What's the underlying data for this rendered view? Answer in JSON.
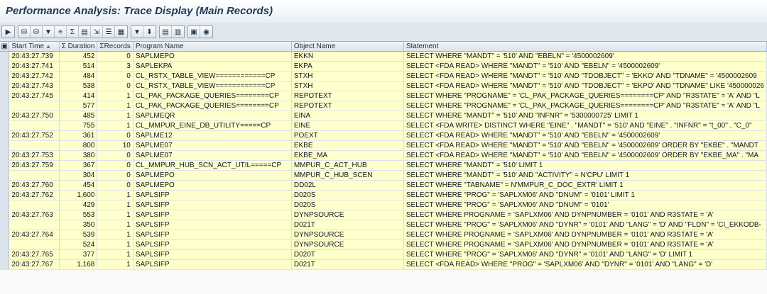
{
  "window": {
    "title": "Performance Analysis: Trace Display (Main Records)"
  },
  "toolbar": {
    "groups": [
      {
        "buttons": [
          {
            "name": "execute-icon",
            "glyph": "▶"
          }
        ]
      },
      {
        "buttons": [
          {
            "name": "find-icon",
            "glyph": "⛁"
          },
          {
            "name": "find-next-icon",
            "glyph": "⛁"
          },
          {
            "name": "filter-icon",
            "glyph": "▼"
          },
          {
            "name": "sort-icon",
            "glyph": "≡"
          },
          {
            "name": "sum-icon",
            "glyph": "Σ"
          },
          {
            "name": "layout-icon",
            "glyph": "▤"
          },
          {
            "name": "export-icon",
            "glyph": "⇲"
          },
          {
            "name": "details-icon",
            "glyph": "☰"
          },
          {
            "name": "view-icon",
            "glyph": "▦"
          }
        ]
      },
      {
        "buttons": [
          {
            "name": "down-icon",
            "glyph": "▼"
          },
          {
            "name": "bottom-icon",
            "glyph": "⬇"
          }
        ]
      },
      {
        "buttons": [
          {
            "name": "explain-icon",
            "glyph": "▤"
          },
          {
            "name": "abap-icon",
            "glyph": "▥"
          }
        ]
      },
      {
        "buttons": [
          {
            "name": "print-icon",
            "glyph": "▣"
          },
          {
            "name": "info-icon",
            "glyph": "◉"
          }
        ]
      }
    ]
  },
  "grid": {
    "columns": {
      "start_time": "Start Time",
      "duration": "Duration",
      "records": "Records",
      "program": "Program Name",
      "object": "Object Name",
      "statement": "Statement"
    },
    "rows": [
      {
        "start": "20:43:27.739",
        "dur": "452",
        "rec": "0",
        "prog": "SAPLMEPO",
        "obj": "EKKN",
        "stmt": "SELECT  WHERE \"MANDT\" = '510' AND \"EBELN\" = '4500002609'"
      },
      {
        "start": "20:43:27.741",
        "dur": "514",
        "rec": "3",
        "prog": "SAPLEKPA",
        "obj": "EKPA",
        "stmt": "SELECT <FDA READ>  WHERE \"MANDT\" = '510' AND \"EBELN\" = '4500002609'"
      },
      {
        "start": "20:43:27.742",
        "dur": "484",
        "rec": "0",
        "prog": "CL_RSTX_TABLE_VIEW============CP",
        "obj": "STXH",
        "stmt": "SELECT <FDA READ>  WHERE \"MANDT\" = '510' AND \"TDOBJECT\" = 'EKKO' AND \"TDNAME\" = '4500002609"
      },
      {
        "start": "20:43:27.743",
        "dur": "538",
        "rec": "0",
        "prog": "CL_RSTX_TABLE_VIEW============CP",
        "obj": "STXH",
        "stmt": "SELECT <FDA READ>  WHERE \"MANDT\" = '510' AND \"TDOBJECT\" = 'EKPO' AND \"TDNAME\" LIKE '450000026"
      },
      {
        "start": "20:43:27.745",
        "dur": "414",
        "rec": "1",
        "prog": "CL_PAK_PACKAGE_QUERIES========CP",
        "obj": "REPOTEXT",
        "stmt": "SELECT  WHERE \"PROGNAME\" = 'CL_PAK_PACKAGE_QUERIES========CP' AND \"R3STATE\" = 'A' AND \"L"
      },
      {
        "start": "",
        "dur": "577",
        "rec": "1",
        "prog": "CL_PAK_PACKAGE_QUERIES========CP",
        "obj": "REPOTEXT",
        "stmt": "SELECT  WHERE \"PROGNAME\" = 'CL_PAK_PACKAGE_QUERIES========CP' AND \"R3STATE\" = 'A' AND \"L"
      },
      {
        "start": "20:43:27.750",
        "dur": "485",
        "rec": "1",
        "prog": "SAPLMEQR",
        "obj": "EINA",
        "stmt": "SELECT  WHERE \"MANDT\" = '510' AND \"INFNR\" = '5300000725'  LIMIT 1"
      },
      {
        "start": "",
        "dur": "755",
        "rec": "1",
        "prog": "CL_MMPUR_EINE_DB_UTILITY=====CP",
        "obj": "EINE",
        "stmt": "SELECT <FDA WRITE> DISTINCT  WHERE \"EINE\" . \"MANDT\" = '510' AND \"EINE\" . \"INFNR\" = \"t_00\" . \"C_0\""
      },
      {
        "start": "20:43:27.752",
        "dur": "361",
        "rec": "0",
        "prog": "SAPLME12",
        "obj": "POEXT",
        "stmt": "SELECT <FDA READ>  WHERE \"MANDT\" = '510' AND \"EBELN\" = '4500002609'"
      },
      {
        "start": "",
        "dur": "800",
        "rec": "10",
        "prog": "SAPLME07",
        "obj": "EKBE",
        "stmt": "SELECT <FDA READ>  WHERE \"MANDT\" = '510' AND \"EBELN\" = '4500002609'  ORDER BY \"EKBE\" . \"MANDT"
      },
      {
        "start": "20:43:27.753",
        "dur": "380",
        "rec": "0",
        "prog": "SAPLME07",
        "obj": "EKBE_MA",
        "stmt": "SELECT <FDA READ>  WHERE \"MANDT\" = '510' AND \"EBELN\" = '4500002609'  ORDER BY \"EKBE_MA\" . \"MA"
      },
      {
        "start": "20:43:27.759",
        "dur": "367",
        "rec": "0",
        "prog": "CL_MMPUR_HUB_SCN_ACT_UTIL=====CP",
        "obj": "MMPUR_C_ACT_HUB",
        "stmt": "SELECT  WHERE \"MANDT\" = '510'  LIMIT 1"
      },
      {
        "start": "",
        "dur": "304",
        "rec": "0",
        "prog": "SAPLMEPO",
        "obj": "MMPUR_C_HUB_SCEN",
        "stmt": "SELECT  WHERE \"MANDT\" = '510'  AND \"ACTIVITY\" = N'CPU' LIMIT 1"
      },
      {
        "start": "20:43:27.760",
        "dur": "454",
        "rec": "0",
        "prog": "SAPLMEPO",
        "obj": "DD02L",
        "stmt": "SELECT WHERE \"TABNAME\" = N'MMPUR_C_DOC_EXTR' LIMIT 1"
      },
      {
        "start": "20:43:27.762",
        "dur": "1,600",
        "rec": "1",
        "prog": "SAPLSIFP",
        "obj": "D020S",
        "stmt": "SELECT  WHERE \"PROG\" = 'SAPLXM06' AND \"DNUM\" = '0101'  LIMIT 1"
      },
      {
        "start": "",
        "dur": "429",
        "rec": "1",
        "prog": "SAPLSIFP",
        "obj": "D020S",
        "stmt": "SELECT  WHERE \"PROG\" = 'SAPLXM06' AND \"DNUM\" = '0101'"
      },
      {
        "start": "20:43:27.763",
        "dur": "553",
        "rec": "1",
        "prog": "SAPLSIFP",
        "obj": "DYNPSOURCE",
        "stmt": "SELECT  WHERE PROGNAME = 'SAPLXM06' AND DYNPNUMBER = '0101'  AND R3STATE = 'A'"
      },
      {
        "start": "",
        "dur": "350",
        "rec": "1",
        "prog": "SAPLSIFP",
        "obj": "D021T",
        "stmt": "SELECT  WHERE \"PROG\" = 'SAPLXM06' AND \"DYNR\" = '0101' AND \"LANG\" = 'D' AND \"FLDN\" = 'CI_EKKODB-"
      },
      {
        "start": "20:43:27.764",
        "dur": "539",
        "rec": "1",
        "prog": "SAPLSIFP",
        "obj": "DYNPSOURCE",
        "stmt": "SELECT  WHERE PROGNAME = 'SAPLXM06' AND DYNPNUMBER = '0101'  AND R3STATE = 'A'"
      },
      {
        "start": "",
        "dur": "524",
        "rec": "1",
        "prog": "SAPLSIFP",
        "obj": "DYNPSOURCE",
        "stmt": "SELECT  WHERE PROGNAME = 'SAPLXM06' AND DYNPNUMBER = '0101'  AND R3STATE = 'A'"
      },
      {
        "start": "20:43:27.765",
        "dur": "377",
        "rec": "1",
        "prog": "SAPLSIFP",
        "obj": "D020T",
        "stmt": "SELECT  WHERE \"PROG\" = 'SAPLXM06' AND \"DYNR\" = '0101' AND \"LANG\" = 'D'  LIMIT 1"
      },
      {
        "start": "20:43:27.767",
        "dur": "1,168",
        "rec": "1",
        "prog": "SAPLSIFP",
        "obj": "D021T",
        "stmt": "SELECT <FDA READ>  WHERE \"PROG\" = 'SAPLXM06' AND \"DYNR\" = '0101' AND \"LANG\" = 'D'"
      }
    ]
  },
  "colors": {
    "row_background": "#ffffcc",
    "header_background": "#dbe3ec",
    "title_color": "#1f3a5a"
  }
}
